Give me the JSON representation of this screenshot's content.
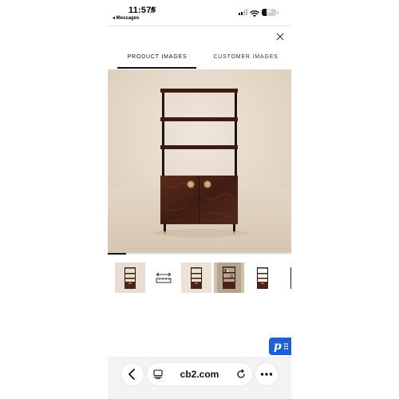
{
  "status_bar": {
    "time": "11:57",
    "back_app": "◂ Messages",
    "battery": "35",
    "battery_level": 0.35,
    "signal_bars_active": 2
  },
  "tabs": [
    {
      "label": "PRODUCT IMAGES",
      "active": true
    },
    {
      "label": "CUSTOMER IMAGES",
      "active": false
    }
  ],
  "gallery": {
    "progress": 0.1,
    "thumbnails": [
      {
        "icon": "bookcase-image",
        "selected": true
      },
      {
        "icon": "dimensions-icon",
        "selected": false
      },
      {
        "icon": "bookcase-image",
        "selected": false
      },
      {
        "icon": "bookcase-styled-image",
        "selected": false
      },
      {
        "icon": "bookcase-image",
        "selected": false
      },
      {
        "icon": "bookcase-image",
        "selected": false
      }
    ]
  },
  "floating_button": {
    "label": "p"
  },
  "browser": {
    "url": "cb2.com",
    "icons": [
      "back-icon",
      "tabs-icon",
      "reload-icon",
      "more-icon"
    ]
  },
  "colors": {
    "accent_blue": "#1f5fd6",
    "wall": "#e8ddd0",
    "wood": "#4a2418",
    "brass": "#b89a6a"
  }
}
